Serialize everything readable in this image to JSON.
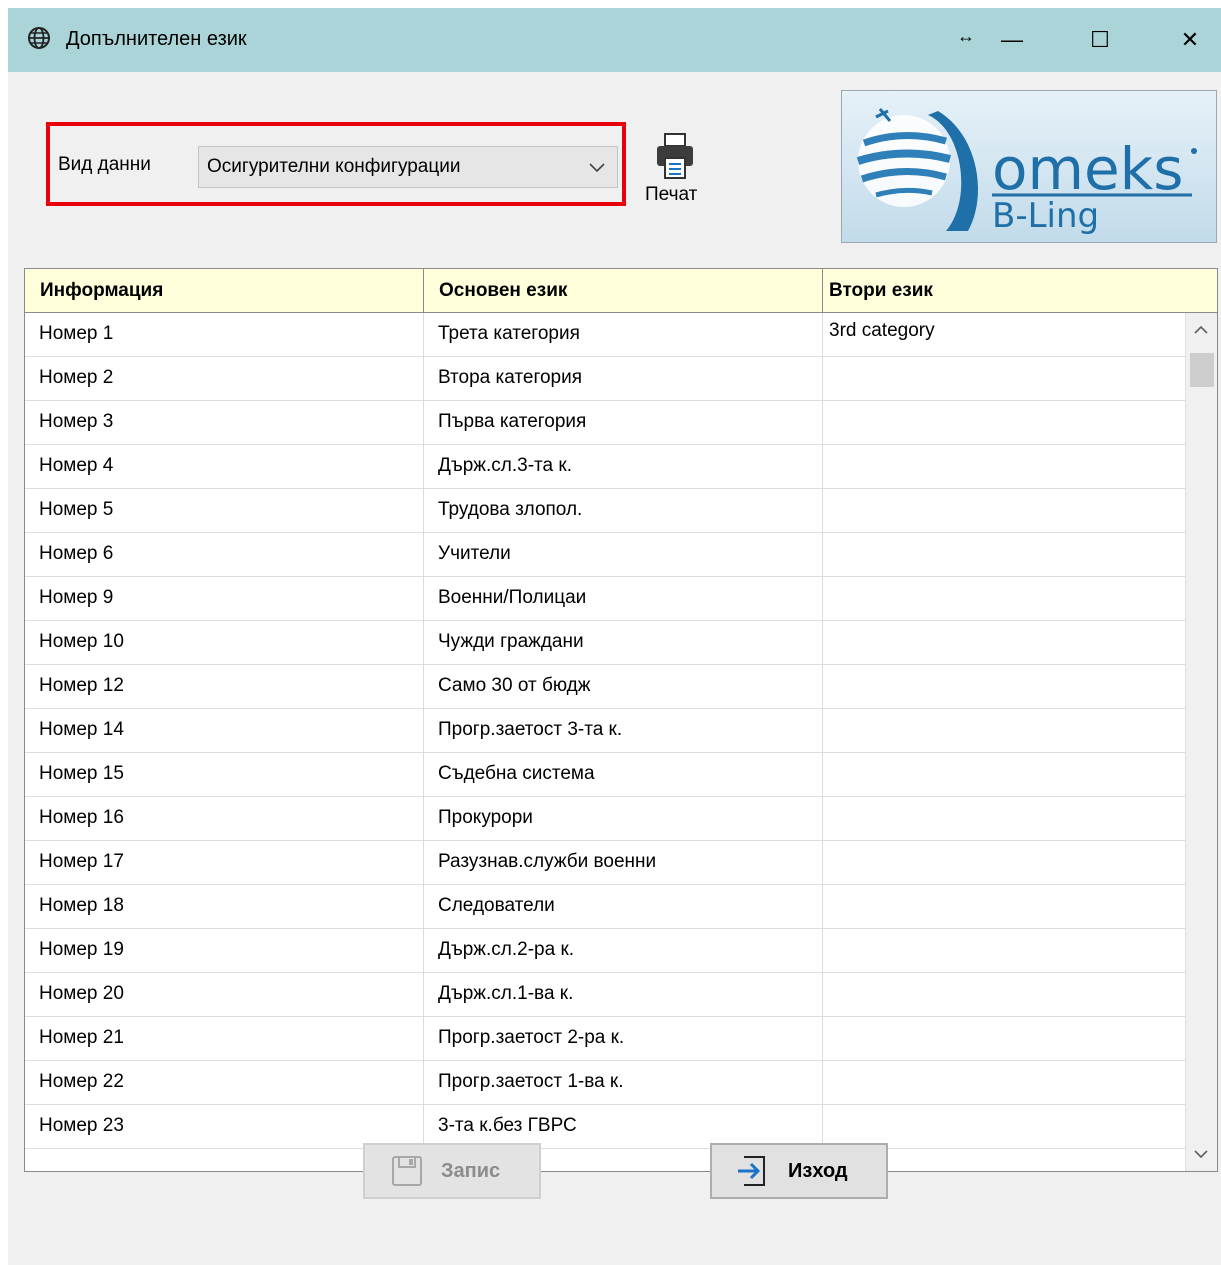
{
  "window": {
    "title": "Допълнителен език",
    "controls": {
      "resize": "↔",
      "minimize": "—",
      "maximize": "☐",
      "close": "✕"
    }
  },
  "filter": {
    "label": "Вид данни",
    "selected": "Осигурителни конфигурации",
    "highlight_color": "#e8000b"
  },
  "print": {
    "label": "Печат"
  },
  "logo": {
    "icon": "omeks-b-ling-logo"
  },
  "grid": {
    "columns": [
      "Информация",
      "Основен език",
      "Втори език"
    ],
    "rows": [
      {
        "info": "Номер 1",
        "main": "Трета категория",
        "second": "3rd category"
      },
      {
        "info": "Номер 2",
        "main": "Втора категория",
        "second": ""
      },
      {
        "info": "Номер 3",
        "main": "Първа категория",
        "second": ""
      },
      {
        "info": "Номер 4",
        "main": "Държ.сл.3-та к.",
        "second": ""
      },
      {
        "info": "Номер 5",
        "main": "Трудова злопол.",
        "second": ""
      },
      {
        "info": "Номер 6",
        "main": "Учители",
        "second": ""
      },
      {
        "info": "Номер 9",
        "main": "Военни/Полицаи",
        "second": ""
      },
      {
        "info": "Номер 10",
        "main": "Чужди граждани",
        "second": ""
      },
      {
        "info": "Номер 12",
        "main": "Само 30 от бюдж",
        "second": ""
      },
      {
        "info": "Номер 14",
        "main": "Прогр.заетост 3-та к.",
        "second": ""
      },
      {
        "info": "Номер 15",
        "main": "Съдебна система",
        "second": ""
      },
      {
        "info": "Номер 16",
        "main": "Прокурори",
        "second": ""
      },
      {
        "info": "Номер 17",
        "main": "Разузнав.служби военни",
        "second": ""
      },
      {
        "info": "Номер 18",
        "main": "Следователи",
        "second": ""
      },
      {
        "info": "Номер 19",
        "main": "Държ.сл.2-ра к.",
        "second": ""
      },
      {
        "info": "Номер 20",
        "main": "Държ.сл.1-ва к.",
        "second": ""
      },
      {
        "info": "Номер 21",
        "main": "Прогр.заетост 2-ра к.",
        "second": ""
      },
      {
        "info": "Номер 22",
        "main": "Прогр.заетост 1-ва к.",
        "second": ""
      },
      {
        "info": "Номер 23",
        "main": "3-та к.без ГВРС",
        "second": ""
      }
    ]
  },
  "buttons": {
    "save": "Запис",
    "exit": "Изход"
  }
}
